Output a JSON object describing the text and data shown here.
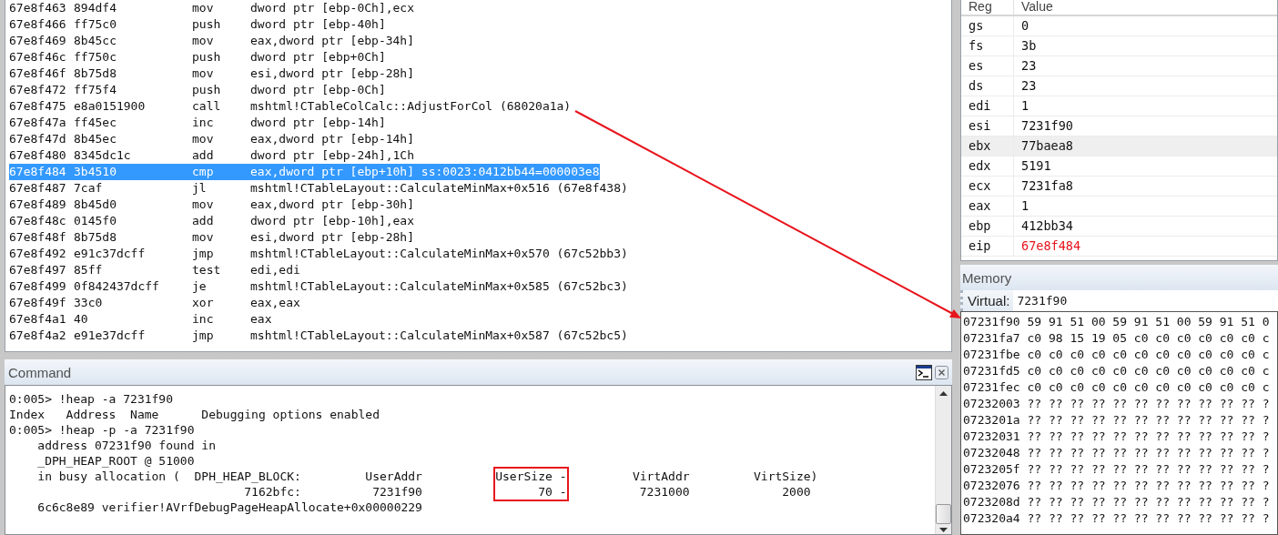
{
  "disassembly": {
    "rows": [
      {
        "address": "67e8f463",
        "bytes": "894df4",
        "mnemonic": "mov",
        "operands": "dword ptr [ebp-0Ch],ecx",
        "selected": false
      },
      {
        "address": "67e8f466",
        "bytes": "ff75c0",
        "mnemonic": "push",
        "operands": "dword ptr [ebp-40h]",
        "selected": false
      },
      {
        "address": "67e8f469",
        "bytes": "8b45cc",
        "mnemonic": "mov",
        "operands": "eax,dword ptr [ebp-34h]",
        "selected": false
      },
      {
        "address": "67e8f46c",
        "bytes": "ff750c",
        "mnemonic": "push",
        "operands": "dword ptr [ebp+0Ch]",
        "selected": false
      },
      {
        "address": "67e8f46f",
        "bytes": "8b75d8",
        "mnemonic": "mov",
        "operands": "esi,dword ptr [ebp-28h]",
        "selected": false
      },
      {
        "address": "67e8f472",
        "bytes": "ff75f4",
        "mnemonic": "push",
        "operands": "dword ptr [ebp-0Ch]",
        "selected": false
      },
      {
        "address": "67e8f475",
        "bytes": "e8a0151900",
        "mnemonic": "call",
        "operands": "mshtml!CTableColCalc::AdjustForCol (68020a1a)",
        "selected": false
      },
      {
        "address": "67e8f47a",
        "bytes": "ff45ec",
        "mnemonic": "inc",
        "operands": "dword ptr [ebp-14h]",
        "selected": false
      },
      {
        "address": "67e8f47d",
        "bytes": "8b45ec",
        "mnemonic": "mov",
        "operands": "eax,dword ptr [ebp-14h]",
        "selected": false
      },
      {
        "address": "67e8f480",
        "bytes": "8345dc1c",
        "mnemonic": "add",
        "operands": "dword ptr [ebp-24h],1Ch",
        "selected": false
      },
      {
        "address": "67e8f484",
        "bytes": "3b4510",
        "mnemonic": "cmp",
        "operands": "eax,dword ptr [ebp+10h] ss:0023:0412bb44=000003e8",
        "selected": true
      },
      {
        "address": "67e8f487",
        "bytes": "7caf",
        "mnemonic": "jl",
        "operands": "mshtml!CTableLayout::CalculateMinMax+0x516 (67e8f438)",
        "selected": false
      },
      {
        "address": "67e8f489",
        "bytes": "8b45d0",
        "mnemonic": "mov",
        "operands": "eax,dword ptr [ebp-30h]",
        "selected": false
      },
      {
        "address": "67e8f48c",
        "bytes": "0145f0",
        "mnemonic": "add",
        "operands": "dword ptr [ebp-10h],eax",
        "selected": false
      },
      {
        "address": "67e8f48f",
        "bytes": "8b75d8",
        "mnemonic": "mov",
        "operands": "esi,dword ptr [ebp-28h]",
        "selected": false
      },
      {
        "address": "67e8f492",
        "bytes": "e91c37dcff",
        "mnemonic": "jmp",
        "operands": "mshtml!CTableLayout::CalculateMinMax+0x570 (67c52bb3)",
        "selected": false
      },
      {
        "address": "67e8f497",
        "bytes": "85ff",
        "mnemonic": "test",
        "operands": "edi,edi",
        "selected": false
      },
      {
        "address": "67e8f499",
        "bytes": "0f842437dcff",
        "mnemonic": "je",
        "operands": "mshtml!CTableLayout::CalculateMinMax+0x585 (67c52bc3)",
        "selected": false
      },
      {
        "address": "67e8f49f",
        "bytes": "33c0",
        "mnemonic": "xor",
        "operands": "eax,eax",
        "selected": false
      },
      {
        "address": "67e8f4a1",
        "bytes": "40",
        "mnemonic": "inc",
        "operands": "eax",
        "selected": false
      },
      {
        "address": "67e8f4a2",
        "bytes": "e91e37dcff",
        "mnemonic": "jmp",
        "operands": "mshtml!CTableLayout::CalculateMinMax+0x587 (67c52bc5)",
        "selected": false
      }
    ]
  },
  "command": {
    "title": "Command",
    "lines": [
      "0:005> !heap -a 7231f90",
      "Index   Address  Name      Debugging options enabled",
      "0:005> !heap -p -a 7231f90",
      "    address 07231f90 found in",
      "    _DPH_HEAP_ROOT @ 51000"
    ],
    "allocation_table": {
      "rows": [
        {
          "prefix": "    in busy allocation (  DPH_HEAP_BLOCK:         UserAddr",
          "highlighted": "UserSize -",
          "suffix": "VirtAddr         VirtSize)"
        },
        {
          "prefix": "                                 7162bfc:          7231f90",
          "highlighted": "      70 -",
          "suffix": " 7231000             2000"
        }
      ]
    },
    "trailing_lines": [
      "    6c6c8e89 verifier!AVrfDebugPageHeapAllocate+0x00000229"
    ]
  },
  "registers": {
    "columns": [
      "Reg",
      "Value"
    ],
    "rows": [
      {
        "name": "gs",
        "value": "0",
        "selected": false,
        "changed": false
      },
      {
        "name": "fs",
        "value": "3b",
        "selected": false,
        "changed": false
      },
      {
        "name": "es",
        "value": "23",
        "selected": false,
        "changed": false
      },
      {
        "name": "ds",
        "value": "23",
        "selected": false,
        "changed": false
      },
      {
        "name": "edi",
        "value": "1",
        "selected": false,
        "changed": false
      },
      {
        "name": "esi",
        "value": "7231f90",
        "selected": false,
        "changed": false
      },
      {
        "name": "ebx",
        "value": "77baea8",
        "selected": true,
        "changed": false
      },
      {
        "name": "edx",
        "value": "5191",
        "selected": false,
        "changed": false
      },
      {
        "name": "ecx",
        "value": "7231fa8",
        "selected": false,
        "changed": false
      },
      {
        "name": "eax",
        "value": "1",
        "selected": false,
        "changed": false
      },
      {
        "name": "ebp",
        "value": "412bb34",
        "selected": false,
        "changed": false
      },
      {
        "name": "eip",
        "value": "67e8f484",
        "selected": false,
        "changed": true
      }
    ]
  },
  "memory": {
    "title": "Memory",
    "address_label": "Virtual:",
    "address_value": "7231f90",
    "rows": [
      {
        "address": "07231f90",
        "bytes": "59 91 51 00 59 91 51 00 59 91 51 0"
      },
      {
        "address": "07231fa7",
        "bytes": "c0 98 15 19 05 c0 c0 c0 c0 c0 c0 c"
      },
      {
        "address": "07231fbe",
        "bytes": "c0 c0 c0 c0 c0 c0 c0 c0 c0 c0 c0 c"
      },
      {
        "address": "07231fd5",
        "bytes": "c0 c0 c0 c0 c0 c0 c0 c0 c0 c0 c0 c"
      },
      {
        "address": "07231fec",
        "bytes": "c0 c0 c0 c0 c0 c0 c0 c0 c0 c0 c0 c"
      },
      {
        "address": "07232003",
        "bytes": "?? ?? ?? ?? ?? ?? ?? ?? ?? ?? ?? ?"
      },
      {
        "address": "0723201a",
        "bytes": "?? ?? ?? ?? ?? ?? ?? ?? ?? ?? ?? ?"
      },
      {
        "address": "07232031",
        "bytes": "?? ?? ?? ?? ?? ?? ?? ?? ?? ?? ?? ?"
      },
      {
        "address": "07232048",
        "bytes": "?? ?? ?? ?? ?? ?? ?? ?? ?? ?? ?? ?"
      },
      {
        "address": "0723205f",
        "bytes": "?? ?? ?? ?? ?? ?? ?? ?? ?? ?? ?? ?"
      },
      {
        "address": "07232076",
        "bytes": "?? ?? ?? ?? ?? ?? ?? ?? ?? ?? ?? ?"
      },
      {
        "address": "0723208d",
        "bytes": "?? ?? ?? ?? ?? ?? ?? ?? ?? ?? ?? ?"
      },
      {
        "address": "072320a4",
        "bytes": "?? ?? ?? ?? ?? ?? ?? ?? ?? ?? ?? ?"
      }
    ]
  }
}
